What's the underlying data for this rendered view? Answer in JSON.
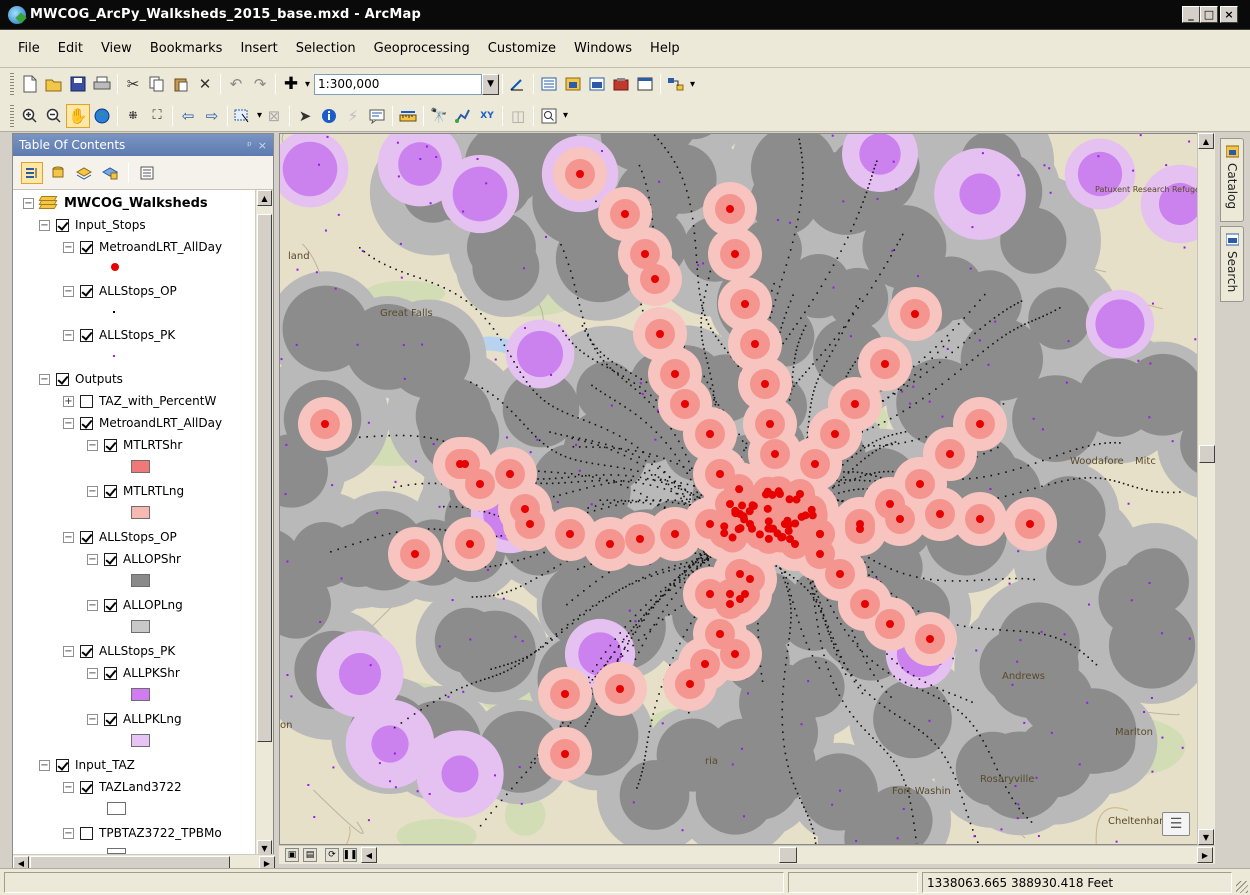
{
  "window": {
    "title": "MWCOG_ArcPy_Walksheds_2015_base.mxd - ArcMap",
    "minimize": "_",
    "maximize": "□",
    "close": "×"
  },
  "menu": [
    "File",
    "Edit",
    "View",
    "Bookmarks",
    "Insert",
    "Selection",
    "Geoprocessing",
    "Customize",
    "Windows",
    "Help"
  ],
  "toolbar": {
    "scale": "1:300,000",
    "scale_caret": "▼",
    "more": "▾"
  },
  "toc": {
    "title": "Table Of Contents",
    "header_buttons": [
      "ᵖ",
      "×"
    ],
    "layers": [
      {
        "label": "MWCOG_Walksheds",
        "indent": 0,
        "expander": "⊟",
        "root": true
      },
      {
        "label": "Input_Stops",
        "indent": 1,
        "expander": "⊟",
        "checked": true
      },
      {
        "label": "MetroandLRT_AllDay",
        "indent": 2,
        "expander": "⊟",
        "checked": true,
        "symbol": "red-dot"
      },
      {
        "label": "ALLStops_OP",
        "indent": 2,
        "expander": "⊟",
        "checked": true,
        "symbol": "black-dot"
      },
      {
        "label": "ALLStops_PK",
        "indent": 2,
        "expander": "⊟",
        "checked": true,
        "symbol": "purple-dot"
      },
      {
        "label": "Outputs",
        "indent": 1,
        "expander": "⊟",
        "checked": true
      },
      {
        "label": "TAZ_with_PercentW",
        "indent": 2,
        "expander": "⊞",
        "checked": false
      },
      {
        "label": "MetroandLRT_AllDay",
        "indent": 2,
        "expander": "⊟",
        "checked": true
      },
      {
        "label": "MTLRTShr",
        "indent": 3,
        "expander": "⊟",
        "checked": true,
        "symbol": "patch",
        "color": "#f07878"
      },
      {
        "label": "MTLRTLng",
        "indent": 3,
        "expander": "⊟",
        "checked": true,
        "symbol": "patch",
        "color": "#f6b9b2"
      },
      {
        "label": "ALLStops_OP",
        "indent": 2,
        "expander": "⊟",
        "checked": true
      },
      {
        "label": "ALLOPShr",
        "indent": 3,
        "expander": "⊟",
        "checked": true,
        "symbol": "patch",
        "color": "#8a8a8a"
      },
      {
        "label": "ALLOPLng",
        "indent": 3,
        "expander": "⊟",
        "checked": true,
        "symbol": "patch",
        "color": "#c8c8c8"
      },
      {
        "label": "ALLStops_PK",
        "indent": 2,
        "expander": "⊟",
        "checked": true
      },
      {
        "label": "ALLPKShr",
        "indent": 3,
        "expander": "⊟",
        "checked": true,
        "symbol": "patch",
        "color": "#d07cf0"
      },
      {
        "label": "ALLPKLng",
        "indent": 3,
        "expander": "⊟",
        "checked": true,
        "symbol": "patch",
        "color": "#e8c4f4"
      },
      {
        "label": "Input_TAZ",
        "indent": 1,
        "expander": "⊟",
        "checked": true
      },
      {
        "label": "TAZLand3722",
        "indent": 2,
        "expander": "⊟",
        "checked": true,
        "symbol": "patch",
        "color": "#ffffff"
      },
      {
        "label": "TPBTAZ3722_TPBMo",
        "indent": 2,
        "expander": "⊟",
        "checked": false,
        "symbol": "patch-cut",
        "color": "#ffffff"
      }
    ]
  },
  "map": {
    "place_labels": [
      "land",
      "Great Falls",
      "Patuxent Research Refuge North",
      "Woodafore",
      "Mitc",
      "Fort Washin",
      "Cheltenham",
      "Rosaryville",
      "Marlton",
      "Andrews",
      "ria",
      "on"
    ],
    "colors": {
      "base": "#e7e0c8",
      "gray_short": "#8c8c8c",
      "gray_long": "#b9b9b9",
      "pink_short": "#f49590",
      "pink_long": "#f8c4bf",
      "purple_short": "#cc82ee",
      "purple_long": "#e5c1f2",
      "water": "#b7d3ef",
      "stop": "#e60000"
    }
  },
  "dock_tabs": [
    "Catalog",
    "Search"
  ],
  "status": {
    "coordinates": "1338063.665  388930.418 Feet"
  }
}
